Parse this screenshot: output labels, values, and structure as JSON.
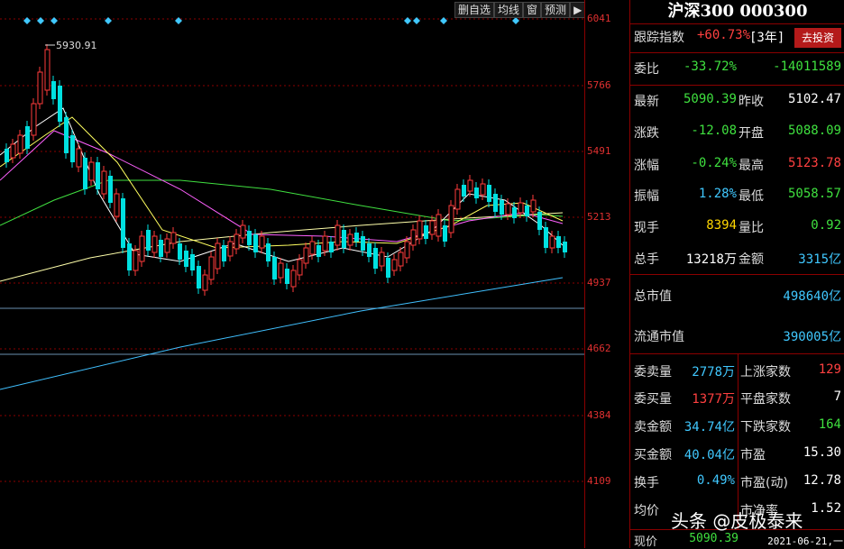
{
  "chart": {
    "peak_label": "5930.91",
    "y_ticks": [
      "6041",
      "5766",
      "5491",
      "5213",
      "4937",
      "4662",
      "4384",
      "4109"
    ],
    "colors": {
      "up": "#ff3b3b",
      "down": "#00e0e0",
      "ma5": "#ffffff",
      "ma10": "#ffff60",
      "ma20": "#ff60ff",
      "ma30": "#40e040",
      "ma60": "#40c0ff",
      "ma120": "#ffffaa"
    }
  },
  "toolbar": {
    "b1": "删自选",
    "b2": "均线",
    "b3": "窗",
    "b4": "预测",
    "b5": "▶"
  },
  "panel": {
    "title": "沪深300 000300",
    "track_label": "跟踪指数",
    "track_value": "+60.73%",
    "track_period": "[3年]",
    "invest_btn": "去投资",
    "weibi_label": "委比",
    "weibi_pct": "-33.72%",
    "weibi_num": "-14011589",
    "latest_label": "最新",
    "latest": "5090.39",
    "prevclose_label": "昨收",
    "prevclose": "5102.47",
    "change_label": "涨跌",
    "change": "-12.08",
    "open_label": "开盘",
    "open": "5088.09",
    "pct_label": "涨幅",
    "pct": "-0.24%",
    "high_label": "最高",
    "high": "5123.78",
    "amp_label": "振幅",
    "amp": "1.28%",
    "low_label": "最低",
    "low": "5058.57",
    "curhand_label": "现手",
    "curhand": "8394",
    "volratio_label": "量比",
    "volratio": "0.92",
    "total_label": "总手",
    "total": "13218万",
    "amount_label": "金额",
    "amount": "3315亿",
    "mktcap_label": "总市值",
    "mktcap": "498640亿",
    "float_label": "流通市值",
    "float": "390005亿",
    "sellvol_label": "委卖量",
    "sellvol": "2778万",
    "buyvol_label": "委买量",
    "buyvol": "1377万",
    "sellamt_label": "卖金额",
    "sellamt": "34.74亿",
    "buyamt_label": "买金额",
    "buyamt": "40.04亿",
    "turnover_label": "换手",
    "turnover": "0.49%",
    "avg_label": "均价",
    "avg": "",
    "up_label": "上涨家数",
    "up": "129",
    "flat_label": "平盘家数",
    "flat": "7",
    "down_label": "下跌家数",
    "down": "164",
    "pe_label": "市盈",
    "pe": "15.30",
    "pedyn_label": "市盈(动)",
    "pedyn": "12.78",
    "pb_label": "市净率",
    "pb": "1.52",
    "now_label": "现价",
    "now": "5090.39",
    "date": "2021-06-21,一"
  },
  "watermark": "头条 @皮极泰来"
}
